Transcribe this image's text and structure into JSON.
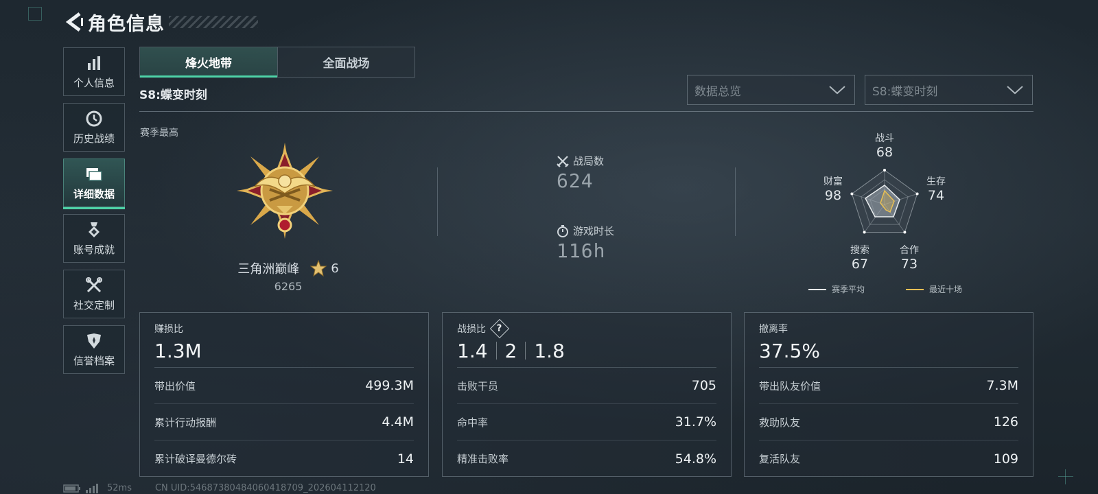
{
  "header": {
    "title": "角色信息"
  },
  "sidebar": {
    "items": [
      {
        "label": "个人信息",
        "icon": "bar-chart-icon"
      },
      {
        "label": "历史战绩",
        "icon": "clock-history-icon"
      },
      {
        "label": "详细数据",
        "icon": "folder-icon",
        "active": true
      },
      {
        "label": "账号成就",
        "icon": "medal-icon"
      },
      {
        "label": "社交定制",
        "icon": "wrench-screwdriver-icon"
      },
      {
        "label": "信誉档案",
        "icon": "shield-icon"
      }
    ]
  },
  "tabs": [
    {
      "label": "烽火地带",
      "active": true
    },
    {
      "label": "全面战场",
      "active": false
    }
  ],
  "season_title": "S8:蝶变时刻",
  "filters": {
    "view": {
      "value": "数据总览"
    },
    "season": {
      "value": "S8:蝶变时刻"
    }
  },
  "season_best": {
    "label": "赛季最高",
    "rank_name": "三角洲巅峰",
    "stars": "6",
    "score": "6265"
  },
  "metrics": {
    "matches": {
      "label": "战局数",
      "value": "624",
      "icon": "crossed-swords-icon"
    },
    "playtime": {
      "label": "游戏时长",
      "value": "116h",
      "icon": "stopwatch-icon"
    }
  },
  "radar": {
    "axes": [
      {
        "label": "战斗",
        "value": "68"
      },
      {
        "label": "生存",
        "value": "74"
      },
      {
        "label": "合作",
        "value": "73"
      },
      {
        "label": "搜索",
        "value": "67"
      },
      {
        "label": "财富",
        "value": "98"
      }
    ],
    "legend": [
      {
        "label": "赛季平均",
        "color": "#ffffff"
      },
      {
        "label": "最近十场",
        "color": "#e8c055"
      }
    ]
  },
  "cards": {
    "profit": {
      "title": "赚损比",
      "value": "1.3M",
      "rows": [
        {
          "label": "带出价值",
          "value": "499.3M"
        },
        {
          "label": "累计行动报酬",
          "value": "4.4M"
        },
        {
          "label": "累计破译曼德尔砖",
          "value": "14"
        }
      ]
    },
    "kd": {
      "title": "战损比",
      "help": "?",
      "values": [
        "1.4",
        "2",
        "1.8"
      ],
      "rows": [
        {
          "label": "击败干员",
          "value": "705"
        },
        {
          "label": "命中率",
          "value": "31.7%"
        },
        {
          "label": "精准击败率",
          "value": "54.8%"
        }
      ]
    },
    "extract": {
      "title": "撤离率",
      "value": "37.5%",
      "rows": [
        {
          "label": "带出队友价值",
          "value": "7.3M"
        },
        {
          "label": "救助队友",
          "value": "126"
        },
        {
          "label": "复活队友",
          "value": "109"
        }
      ]
    }
  },
  "footer": {
    "ping": "52ms",
    "uid": "CN UID:5468738048406041870‌9_202604112120"
  },
  "colors": {
    "accent": "#4ed4a8",
    "gold": "#e8c055"
  }
}
